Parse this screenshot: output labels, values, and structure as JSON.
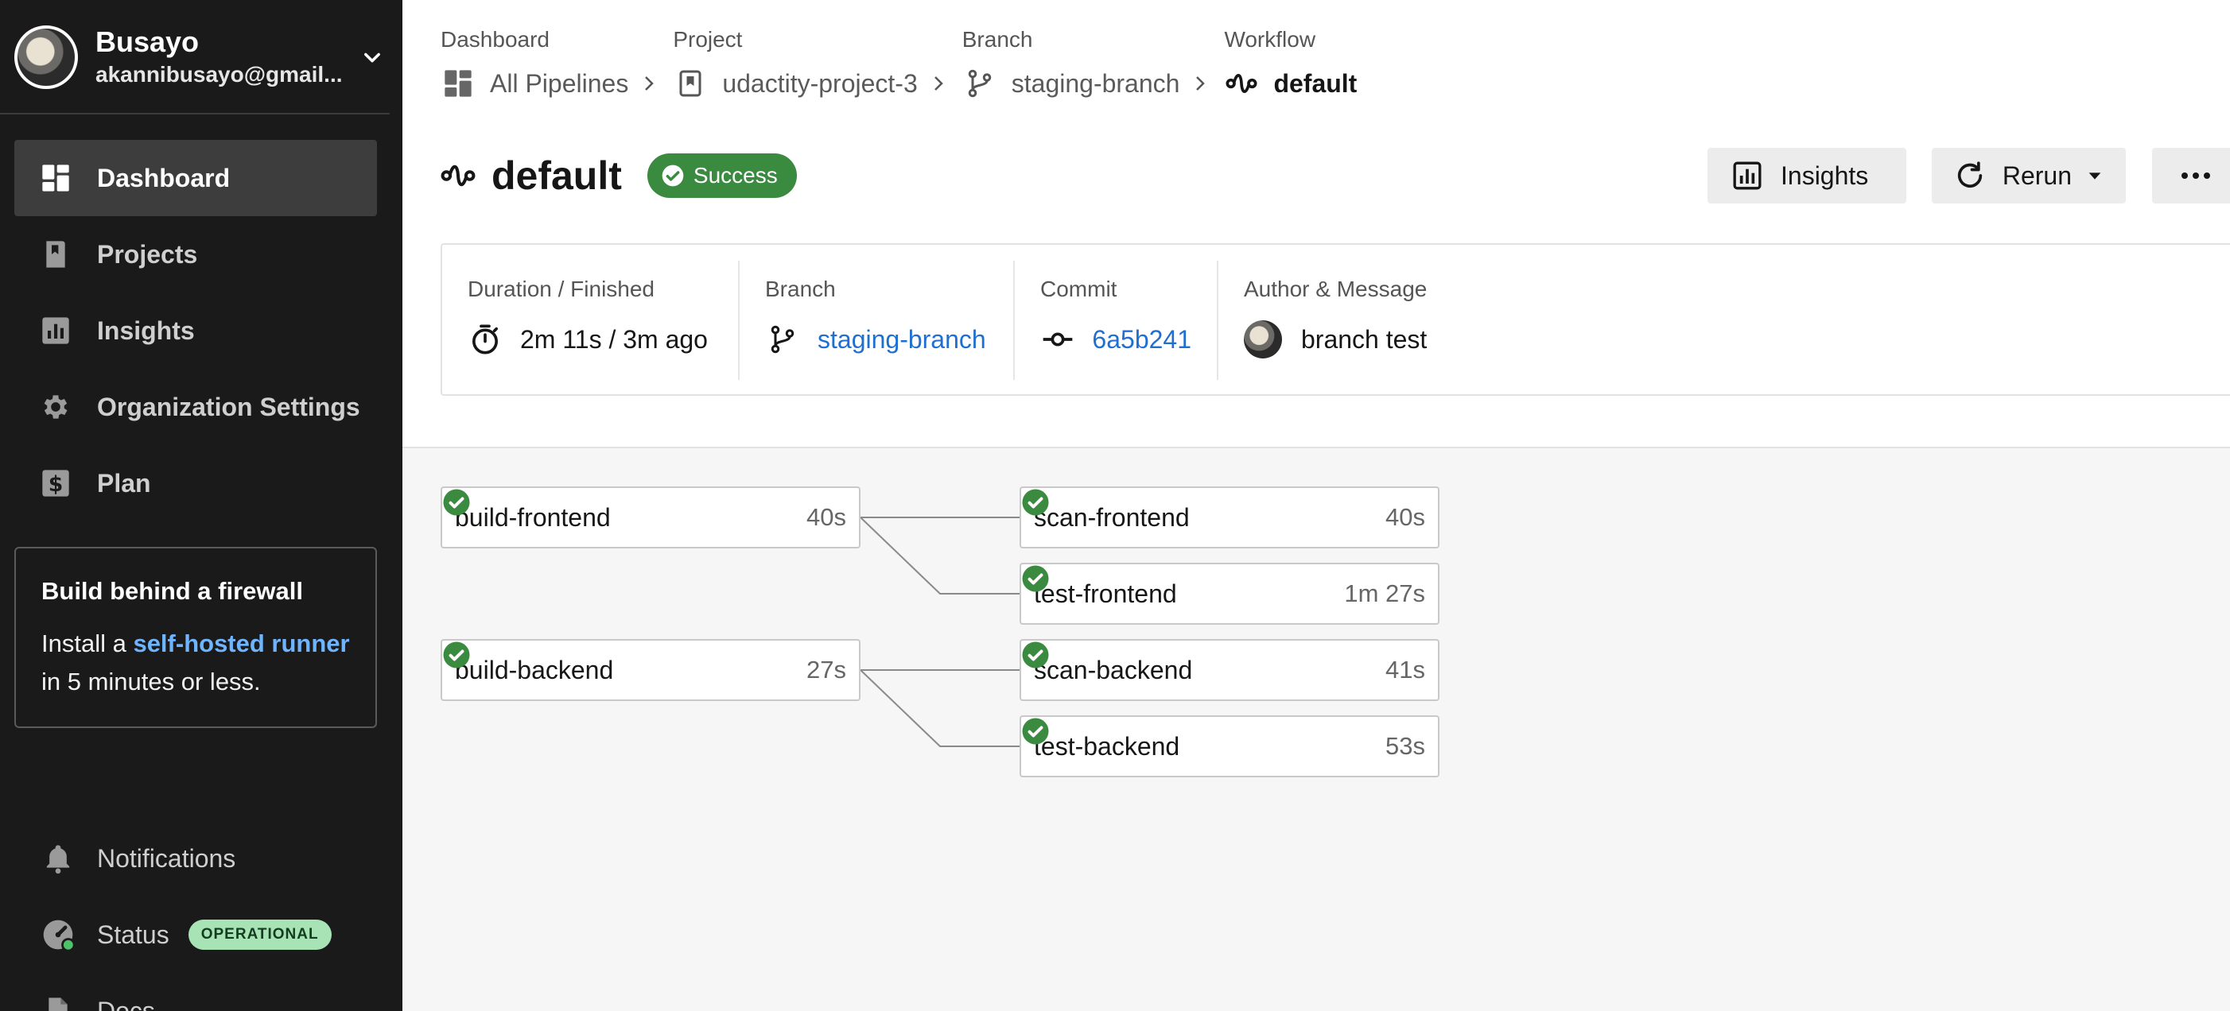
{
  "user": {
    "name": "Busayo",
    "email": "akannibusayo@gmail..."
  },
  "nav": {
    "items": [
      {
        "label": "Dashboard",
        "icon": "dashboard-icon",
        "active": true
      },
      {
        "label": "Projects",
        "icon": "bookmark-icon"
      },
      {
        "label": "Insights",
        "icon": "bar-chart-icon"
      },
      {
        "label": "Organization Settings",
        "icon": "gear-icon"
      },
      {
        "label": "Plan",
        "icon": "dollar-icon"
      }
    ]
  },
  "promo": {
    "title": "Build behind a firewall",
    "body_prefix": "Install a ",
    "link": "self-hosted runner",
    "body_suffix": " in 5 minutes or less."
  },
  "bottom_nav": {
    "notifications": "Notifications",
    "status": "Status",
    "status_badge": "OPERATIONAL",
    "docs": "Docs"
  },
  "breadcrumbs": [
    {
      "caption": "Dashboard",
      "label": "All Pipelines",
      "icon": "grid-icon"
    },
    {
      "caption": "Project",
      "label": "udactity-project-3",
      "icon": "bookmark-icon"
    },
    {
      "caption": "Branch",
      "label": "staging-branch",
      "icon": "branch-icon"
    },
    {
      "caption": "Workflow",
      "label": "default",
      "icon": "workflow-icon"
    }
  ],
  "header": {
    "title": "default",
    "status": "Success",
    "insights_button": "Insights",
    "rerun_button": "Rerun"
  },
  "meta": {
    "duration_caption": "Duration / Finished",
    "duration_value": "2m 11s / 3m ago",
    "branch_caption": "Branch",
    "branch_value": "staging-branch",
    "commit_caption": "Commit",
    "commit_value": "6a5b241",
    "author_caption": "Author & Message",
    "author_message": "branch test"
  },
  "jobs": {
    "build_frontend": {
      "name": "build-frontend",
      "duration": "40s"
    },
    "scan_frontend": {
      "name": "scan-frontend",
      "duration": "40s"
    },
    "test_frontend": {
      "name": "test-frontend",
      "duration": "1m 27s"
    },
    "build_backend": {
      "name": "build-backend",
      "duration": "27s"
    },
    "scan_backend": {
      "name": "scan-backend",
      "duration": "41s"
    },
    "test_backend": {
      "name": "test-backend",
      "duration": "53s"
    }
  },
  "colors": {
    "sidebar_bg": "#1a1a1a",
    "success_green": "#3a8a3f",
    "link_blue": "#1f6fd0",
    "operational_badge": "#a7e3b5"
  }
}
